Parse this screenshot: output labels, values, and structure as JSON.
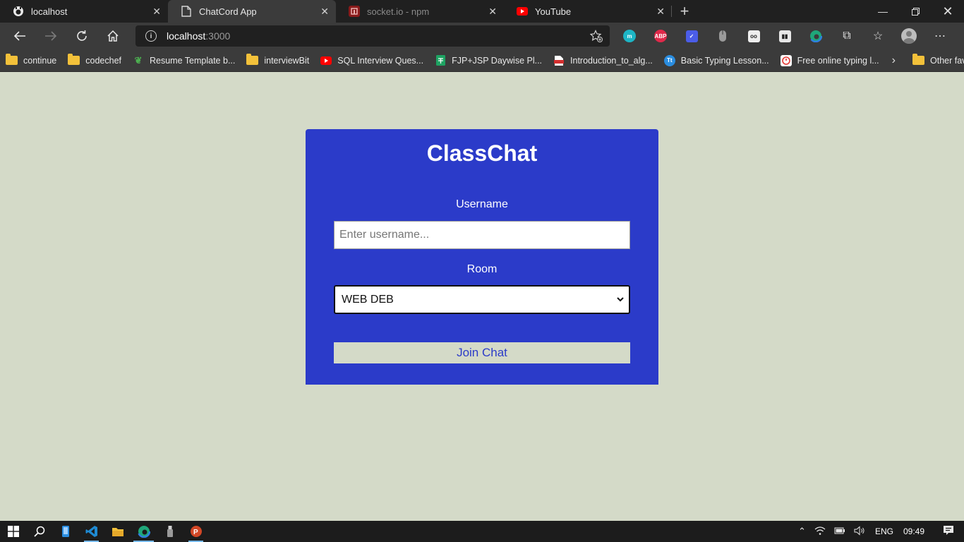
{
  "browser": {
    "tabs": [
      {
        "title": "localhost",
        "icon": "github-icon",
        "state": "normal"
      },
      {
        "title": "ChatCord App",
        "icon": "page-icon",
        "state": "active"
      },
      {
        "title": "socket.io - npm",
        "icon": "npm-icon",
        "state": "dim"
      },
      {
        "title": "YouTube",
        "icon": "youtube-icon",
        "state": "normal"
      }
    ],
    "address": {
      "host": "localhost",
      "port": ":3000"
    },
    "bookmarks": [
      {
        "label": "continue",
        "icon": "folder-icon"
      },
      {
        "label": "codechef",
        "icon": "folder-icon"
      },
      {
        "label": "Resume Template b...",
        "icon": "leaf-icon"
      },
      {
        "label": "interviewBit",
        "icon": "folder-icon"
      },
      {
        "label": "SQL Interview Ques...",
        "icon": "youtube-icon"
      },
      {
        "label": "FJP+JSP Daywise Pl...",
        "icon": "sheets-icon"
      },
      {
        "label": "Introduction_to_alg...",
        "icon": "pdf-icon"
      },
      {
        "label": "Basic Typing Lesson...",
        "icon": "typing-icon"
      },
      {
        "label": "Free online typing l...",
        "icon": "timer-icon"
      }
    ],
    "other_favorites": "Other favorites"
  },
  "app": {
    "title": "ClassChat",
    "username_label": "Username",
    "username_placeholder": "Enter username...",
    "room_label": "Room",
    "room_selected": "WEB DEB",
    "join_label": "Join Chat"
  },
  "taskbar": {
    "language": "ENG",
    "time": "09:49"
  },
  "colors": {
    "card": "#2b3bc9",
    "page_bg": "#d4dac8"
  }
}
